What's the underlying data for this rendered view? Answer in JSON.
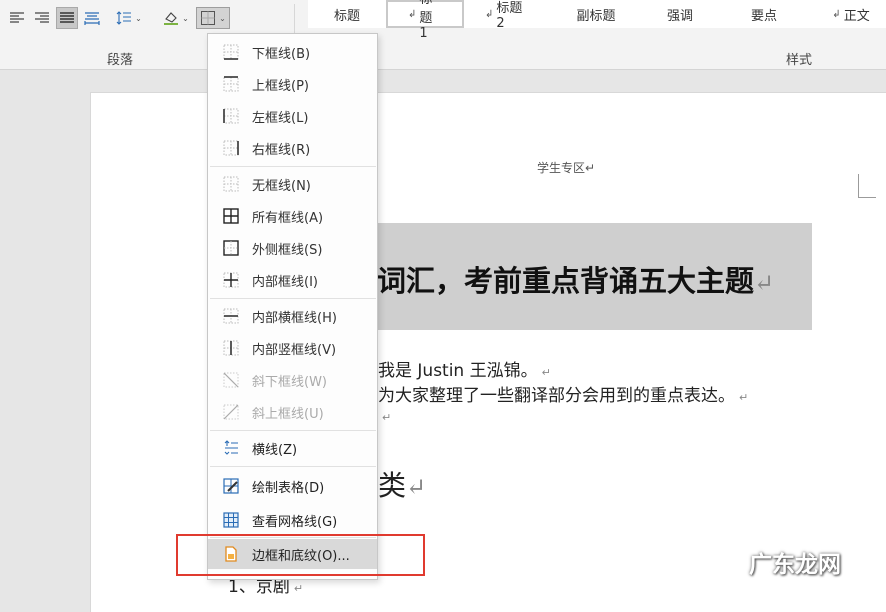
{
  "ribbon": {
    "paragraph_group_label": "段落",
    "styles_group_label": "样式",
    "styles": [
      {
        "label": "标题",
        "mark": ""
      },
      {
        "label": "标题 1",
        "mark": "↲"
      },
      {
        "label": "标题 2",
        "mark": "↲"
      },
      {
        "label": "副标题",
        "mark": ""
      },
      {
        "label": "强调",
        "mark": ""
      },
      {
        "label": "要点",
        "mark": ""
      },
      {
        "label": "正文",
        "mark": "↲"
      }
    ],
    "tools": [
      "align-left-icon",
      "align-right-icon",
      "justify-icon",
      "distributed-icon",
      "line-spacing-icon",
      "shading-icon",
      "borders-icon"
    ]
  },
  "document": {
    "header": "学生专区↵",
    "title": "词汇，考前重点背诵五大主题",
    "title_mark": "↵",
    "line1": "我是 Justin 王泓锦。",
    "line2": "为大家整理了一些翻译部分会用到的重点表达。",
    "heading_frag": "类",
    "heading_mark": "↵",
    "item1": "1、京剧",
    "item_mark": "↵",
    "para_mark": "↵"
  },
  "border_menu": {
    "items": [
      {
        "label": "下框线(B)",
        "icon": "bottom-border-icon"
      },
      {
        "label": "上框线(P)",
        "icon": "top-border-icon"
      },
      {
        "label": "左框线(L)",
        "icon": "left-border-icon"
      },
      {
        "label": "右框线(R)",
        "icon": "right-border-icon"
      },
      {
        "label": "无框线(N)",
        "icon": "no-border-icon"
      },
      {
        "label": "所有框线(A)",
        "icon": "all-borders-icon"
      },
      {
        "label": "外侧框线(S)",
        "icon": "outside-borders-icon"
      },
      {
        "label": "内部框线(I)",
        "icon": "inside-borders-icon"
      },
      {
        "label": "内部横框线(H)",
        "icon": "inside-horizontal-border-icon"
      },
      {
        "label": "内部竖框线(V)",
        "icon": "inside-vertical-border-icon"
      },
      {
        "label": "斜下框线(W)",
        "icon": "diagonal-down-border-icon"
      },
      {
        "label": "斜上框线(U)",
        "icon": "diagonal-up-border-icon"
      },
      {
        "label": "横线(Z)",
        "icon": "horizontal-line-icon"
      },
      {
        "label": "绘制表格(D)",
        "icon": "draw-table-icon"
      },
      {
        "label": "查看网格线(G)",
        "icon": "view-gridlines-icon"
      },
      {
        "label": "边框和底纹(O)...",
        "icon": "borders-and-shading-icon"
      }
    ]
  },
  "watermark": "广东龙网",
  "colors": {
    "highlight_box": "#e03a2f",
    "title_band": "#cfcfcf",
    "menu_hover": "#d9d9d9"
  }
}
